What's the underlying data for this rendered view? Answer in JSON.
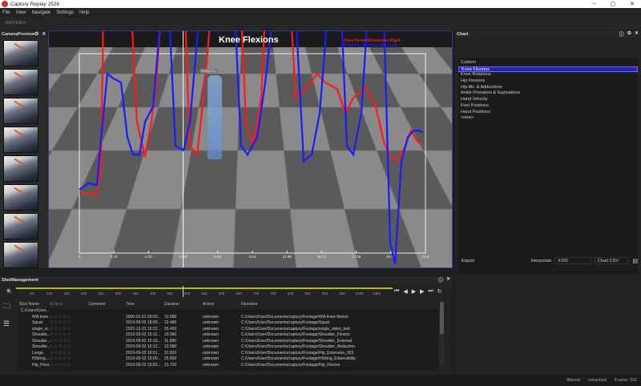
{
  "window": {
    "title": "Captury Replay 252b",
    "controls": [
      "–",
      "▢",
      "✕"
    ]
  },
  "menu": [
    "File",
    "View",
    "Navigate",
    "Settings",
    "Help"
  ],
  "toolbar": {
    "label": "SHOTINFO"
  },
  "camera_preview": {
    "title": "CameraPreview",
    "thumb_count": 8
  },
  "chart_panel": {
    "title": "Chart",
    "items": [
      "Custom",
      "Knee Flexions",
      "Knee Rotations",
      "Hip Flexions",
      "Hip Ab- & Adductions",
      "Ankle Pronation & Supinations",
      "Hand Velocity",
      "Foot Positions",
      "Hand Positions",
      "<new>"
    ],
    "selected": "Knee Flexions",
    "export_label": "Export",
    "interpolate_label": "Interpolate",
    "interpolate_value": "#100",
    "format_value": "Chart CSV"
  },
  "viewport": {
    "skeleton_tag": "Subject-1"
  },
  "chart_data": {
    "type": "line",
    "title": "Knee Flexions",
    "legend_placement": "top-right",
    "x_ticks": [
      "0",
      "2.16",
      "4.32",
      "6.48",
      "8.64",
      "10.8",
      "12.96",
      "15.12",
      "17.28",
      "19.44",
      "21.6"
    ],
    "xlim": [
      0,
      21.6
    ],
    "ylim": [
      0,
      100
    ],
    "grid": false,
    "cursor_x": 6.48,
    "series": [
      {
        "name": "Knee Flexion/Extension Right",
        "color": "#ff1a1a",
        "x": [
          0,
          1,
          1.35,
          1.5,
          3.25,
          3.6,
          4.1,
          4.5,
          4.8,
          5.1,
          6.6,
          6.9,
          7.35,
          7.85,
          8.2,
          10.1,
          10.4,
          10.85,
          11.35,
          11.6,
          13.2,
          13.5,
          14.1,
          14.85,
          15.35,
          16.1,
          16.6,
          17.1,
          17.85,
          18.5,
          19,
          19.35,
          19.85,
          20.35,
          20.7,
          21.1,
          21.45
        ],
        "y": [
          28,
          26.5,
          38,
          110,
          110,
          60,
          44,
          60,
          78,
          110,
          110,
          49,
          45,
          78,
          110,
          110,
          60,
          49,
          71,
          110,
          110,
          71,
          75,
          82,
          78,
          75,
          64,
          71,
          76,
          67,
          51,
          45,
          42,
          49,
          56,
          51,
          49
        ]
      },
      {
        "name": "Knee Flexion/Extension Left",
        "color": "#1a1aff",
        "x": [
          0,
          0.6,
          1.1,
          1.4,
          1.75,
          2.1,
          2.6,
          3,
          3.35,
          3.75,
          4.1,
          4.6,
          5.1,
          5.6,
          6,
          6.5,
          6.9,
          7.5,
          9.7,
          10.1,
          10.5,
          11.1,
          11.6,
          12.1,
          13.5,
          14,
          14.5,
          15,
          15.5,
          16.35,
          16.7,
          17.1,
          17.6,
          18,
          19,
          19.4,
          19.7,
          20.1,
          20.5,
          20.85,
          21.2,
          21.45
        ],
        "y": [
          29,
          32,
          31,
          56,
          82,
          80,
          78,
          53,
          45,
          45,
          60,
          67,
          110,
          110,
          49,
          47,
          60,
          110,
          110,
          49,
          45,
          53,
          78,
          110,
          110,
          42,
          45,
          64,
          110,
          110,
          49,
          45,
          64,
          110,
          110,
          5,
          -5,
          42,
          53,
          56,
          56,
          55
        ]
      }
    ]
  },
  "shot_management": {
    "title": "ShotManagement",
    "timeline_ticks": [
      "50",
      "100",
      "150",
      "200",
      "250",
      "300",
      "350",
      "400",
      "450",
      "500",
      "550",
      "600",
      "650",
      "700",
      "750",
      "800",
      "850",
      "900",
      "950",
      "1000",
      "1050"
    ],
    "columns": [
      "Shot Name",
      "Stars",
      "Comment",
      "Time",
      "Duration",
      "Actors",
      "Filename"
    ],
    "folder": "C:/Users/User...",
    "rows": [
      {
        "name": "Will knee...",
        "stars": "☆☆☆☆☆",
        "comment": "",
        "time": "2000-01-01 00:00...",
        "duration": "31.580",
        "actors": "unknown",
        "file": "C:/Users/User/Documents/captury/Footage/Will-knee-flexion"
      },
      {
        "name": "Squat",
        "stars": "☆☆☆☆☆",
        "comment": "",
        "time": "2019-09-02 18:00...",
        "duration": "22.480",
        "actors": "unknown",
        "file": "C:/Users/User/Documents/captury/Footage/Squat"
      },
      {
        "name": "single_vi...",
        "stars": "☆☆☆☆☆",
        "comment": "",
        "time": "2022-12-31 15:22...",
        "duration": "05.420",
        "actors": "unknown",
        "file": "C:/Users/User/Documents/captury/Footage/single_video_test"
      },
      {
        "name": "Shoulde...",
        "stars": "☆☆☆☆☆",
        "comment": "",
        "time": "2019-09-02 15:11...",
        "duration": "19.080",
        "actors": "unknown",
        "file": "C:/Users/User/Documents/captury/Footage/Shoulder_Flexion"
      },
      {
        "name": "Shoulde...",
        "stars": "☆☆☆☆☆",
        "comment": "",
        "time": "2019-09-02 15:10...",
        "duration": "11.580",
        "actors": "unknown",
        "file": "C:/Users/User/Documents/captury/Footage/Shoulder_External"
      },
      {
        "name": "Shoulde...",
        "stars": "☆☆☆☆☆",
        "comment": "",
        "time": "2019-09-02 15:12...",
        "duration": "12.580",
        "actors": "unknown",
        "file": "C:/Users/User/Documents/captury/Footage/Shoulder_Abduction"
      },
      {
        "name": "Lunge",
        "stars": "☆☆☆☆☆",
        "comment": "",
        "time": "2019-09-02 16:01...",
        "duration": "31.820",
        "actors": "unknown",
        "file": "C:/Users/User/Documents/captury/Footage/Hip_Extension_002"
      },
      {
        "name": "HString...",
        "stars": "☆☆☆☆☆",
        "comment": "",
        "time": "2019-09-02 15:00...",
        "duration": "26.820",
        "actors": "unknown",
        "file": "C:/Users/User/Documents/captury/Footage/HString_Extensibility"
      },
      {
        "name": "Hip_Flexi...",
        "stars": "☆☆☆☆☆",
        "comment": "",
        "time": "2019-09-02 15:55...",
        "duration": "15.720",
        "actors": "unknown",
        "file": "C:/Users/User/Documents/captury/Footage/Hip_Flexion"
      }
    ]
  },
  "status": {
    "filtered": "filtered",
    "retracked": "retracked",
    "frame": "Frame: 332"
  }
}
